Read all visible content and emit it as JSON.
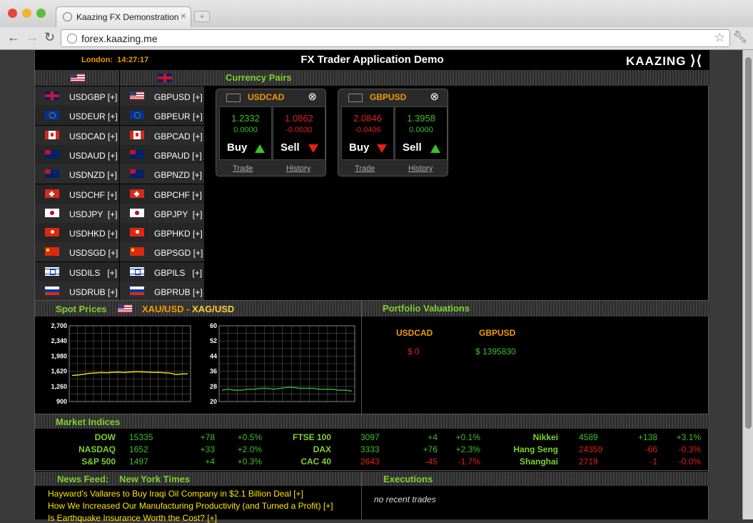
{
  "browser": {
    "tab_title": "Kaazing FX Demonstration",
    "url": "forex.kaazing.me"
  },
  "header": {
    "clock_city": "London:",
    "clock_time": "14:27:17",
    "title": "FX Trader Application Demo",
    "logo": "KAAZING"
  },
  "pairs_list": {
    "left_flag": "us-flag",
    "right_flag": "gb-flag",
    "rows": [
      {
        "flag": "gb",
        "left": "USDGBP [+]",
        "right_flag": "us",
        "right": "GBPUSD [+]"
      },
      {
        "flag": "eu",
        "left": "USDEUR [+]",
        "right_flag": "eu",
        "right": "GBPEUR [+]"
      },
      {
        "flag": "ca",
        "left": "USDCAD [+]",
        "right_flag": "ca",
        "right": "GBPCAD [+]"
      },
      {
        "flag": "au",
        "left": "USDAUD [+]",
        "right_flag": "au",
        "right": "GBPAUD [+]"
      },
      {
        "flag": "nz",
        "left": "USDNZD [+]",
        "right_flag": "nz",
        "right": "GBPNZD [+]"
      },
      {
        "flag": "ch",
        "left": "USDCHF [+]",
        "right_flag": "ch",
        "right": "GBPCHF [+]"
      },
      {
        "flag": "jp",
        "left": "USDJPY  [+]",
        "right_flag": "jp",
        "right": "GBPJPY  [+]"
      },
      {
        "flag": "hk",
        "left": "USDHKD [+]",
        "right_flag": "hk",
        "right": "GBPHKD [+]"
      },
      {
        "flag": "cn",
        "left": "USDSGD [+]",
        "right_flag": "cn",
        "right": "GBPSGD [+]"
      },
      {
        "flag": "il",
        "left": "USDILS   [+]",
        "right_flag": "il",
        "right": "GBPILS   [+]"
      },
      {
        "flag": "ru",
        "left": "USDRUB [+]",
        "right_flag": "ru",
        "right": "GBPRUB [+]"
      }
    ]
  },
  "currency_pairs": {
    "title": "Currency Pairs",
    "widgets": [
      {
        "name": "USDCAD",
        "buy_price": "1.2332",
        "buy_change": "0.0000",
        "buy_color": "green",
        "buy_arrow": "up",
        "sell_price": "1.0862",
        "sell_change": "-0.0030",
        "sell_color": "red",
        "sell_arrow": "down",
        "trade": "Trade",
        "history": "History"
      },
      {
        "name": "GBPUSD",
        "buy_price": "2.0846",
        "buy_change": "-0.0406",
        "buy_color": "red",
        "buy_arrow": "down",
        "sell_price": "1.3958",
        "sell_change": "0.0000",
        "sell_color": "green",
        "sell_arrow": "up",
        "trade": "Trade",
        "history": "History"
      }
    ],
    "buy_label": "Buy",
    "sell_label": "Sell",
    "close_icon": "close-circle-icon"
  },
  "spot_prices": {
    "title": "Spot Prices",
    "pair_primary": "XAU/USD",
    "separator": " - ",
    "pair_secondary": "XAG/USD"
  },
  "chart_data": [
    {
      "type": "line",
      "ylim": [
        900,
        2700
      ],
      "yticks": [
        "2,700",
        "2,340",
        "1,980",
        "1,620",
        "1,260",
        "900"
      ],
      "series": [
        {
          "values": [
            1520,
            1530,
            1550,
            1570,
            1580,
            1590,
            1585,
            1595,
            1600,
            1590,
            1600,
            1610,
            1605,
            1600,
            1590,
            1595,
            1585,
            1575,
            1540,
            1555,
            1560
          ]
        }
      ],
      "color": "#e8e000"
    },
    {
      "type": "line",
      "ylim": [
        20,
        60
      ],
      "yticks": [
        "60",
        "52",
        "44",
        "36",
        "28",
        "20"
      ],
      "series": [
        {
          "values": [
            26,
            26.5,
            26,
            26,
            26.5,
            26.5,
            27,
            27,
            26.5,
            27,
            27.5,
            27.5,
            27,
            27,
            27,
            26.5,
            26.5,
            26.5,
            26,
            26,
            25.5
          ]
        }
      ],
      "color": "#2fae2f"
    }
  ],
  "portfolio": {
    "title": "Portfolio Valuations",
    "items": [
      {
        "pair": "USDCAD",
        "value": "$ 0",
        "color": "red"
      },
      {
        "pair": "GBPUSD",
        "value": "$ 1395830",
        "color": "green"
      }
    ]
  },
  "market_indices": {
    "title": "Market Indices",
    "columns": [
      [
        {
          "name": "DOW",
          "value": "15335",
          "change": "+78",
          "pct": "+0.5%",
          "color": "green"
        },
        {
          "name": "NASDAQ",
          "value": "1652",
          "change": "+33",
          "pct": "+2.0%",
          "color": "green"
        },
        {
          "name": "S&P 500",
          "value": "1497",
          "change": "+4",
          "pct": "+0.3%",
          "color": "green"
        }
      ],
      [
        {
          "name": "FTSE 100",
          "value": "3097",
          "change": "+4",
          "pct": "+0.1%",
          "color": "green"
        },
        {
          "name": "DAX",
          "value": "3333",
          "change": "+76",
          "pct": "+2.3%",
          "color": "green"
        },
        {
          "name": "CAC 40",
          "value": "2643",
          "change": "-45",
          "pct": "-1.7%",
          "color": "red"
        }
      ],
      [
        {
          "name": "Nikkei",
          "value": "4589",
          "change": "+138",
          "pct": "+3.1%",
          "color": "green"
        },
        {
          "name": "Hang Seng",
          "value": "24359",
          "change": "-66",
          "pct": "-0.3%",
          "color": "red"
        },
        {
          "name": "Shanghai",
          "value": "2719",
          "change": "-1",
          "pct": "-0.0%",
          "color": "red"
        }
      ]
    ]
  },
  "news": {
    "title": "News Feed:",
    "source": "New York Times",
    "items": [
      "Hayward's Vallares to Buy Iraqi Oil Company in $2.1 Billion Deal  [+]",
      "How We Increased Our Manufacturing Productivity (and Turned a Profit)  [+]",
      "Is Earthquake Insurance Worth the Cost?  [+]"
    ]
  },
  "executions": {
    "title": "Executions",
    "empty_text": "no recent trades"
  },
  "colors": {
    "accent_orange": "#f29a00",
    "section_green": "#7fd22b",
    "up_green": "#3fbf2a",
    "down_red": "#e0201c",
    "news_yellow": "#ffe600"
  }
}
